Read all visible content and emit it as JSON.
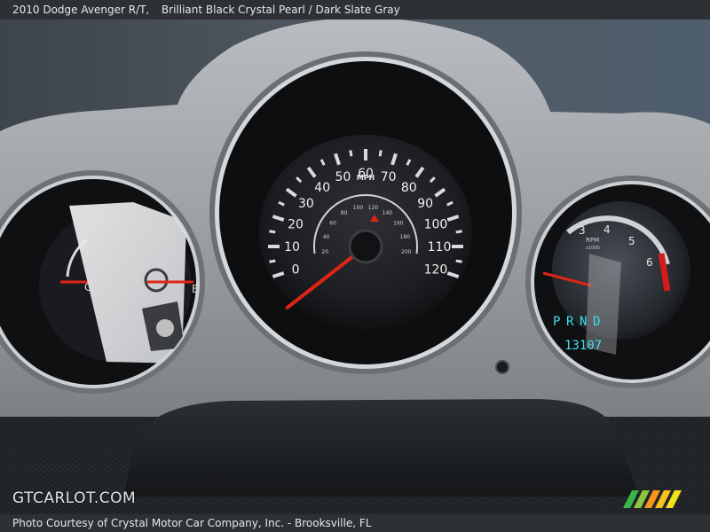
{
  "caption": {
    "title": "2010 Dodge Avenger R/T,",
    "color_info": "Brilliant Black Crystal Pearl / Dark Slate Gray"
  },
  "credit": "Photo Courtesy of Crystal Motor Car Company, Inc. - Brooksville, FL",
  "watermark": "GTCARLOT.COM",
  "speedometer": {
    "unit_label": "MPH",
    "mph_labels": [
      "0",
      "10",
      "20",
      "30",
      "40",
      "50",
      "60",
      "70",
      "80",
      "90",
      "100",
      "110",
      "120"
    ],
    "kmh_labels": [
      "20",
      "40",
      "60",
      "80",
      "100",
      "120",
      "140",
      "160",
      "180",
      "200"
    ],
    "needle_value_mph": 0
  },
  "tachometer": {
    "unit_label": "RPM",
    "unit_sub": "x1000",
    "labels": [
      "3",
      "4",
      "5",
      "6"
    ]
  },
  "temp_gauge": {
    "cold_label": "C"
  },
  "fuel_gauge": {
    "empty_label": "E"
  },
  "gear_indicator": [
    "P",
    "R",
    "N",
    "D"
  ],
  "odometer": "13107",
  "colors": {
    "needle": "#e02418",
    "lcd": "#3ee0e8",
    "trim": "#9ea2a6",
    "dial_face": "#1c1d20",
    "redline": "#d21c1c"
  }
}
